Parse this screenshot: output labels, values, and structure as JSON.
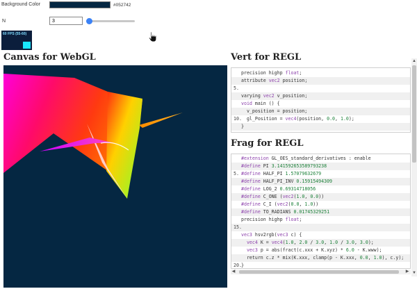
{
  "controls": {
    "bg_label": "Background Color",
    "bg_hex": "#052742",
    "n_label": "N",
    "n_value": "3",
    "n_slider_fraction": 0.03
  },
  "fps": {
    "label": "60 FPS (55-60)"
  },
  "canvas": {
    "title": "Canvas for WebGL"
  },
  "vert": {
    "title": "Vert for REGL",
    "lines": [
      {
        "n": "",
        "t": "precision highp float;"
      },
      {
        "n": "",
        "t": "attribute vec2 position;"
      },
      {
        "n": "5.",
        "t": ""
      },
      {
        "n": "",
        "t": "varying vec2 v_position;"
      },
      {
        "n": "",
        "t": "void main () {"
      },
      {
        "n": "",
        "t": "  v_position = position;"
      },
      {
        "n": "10.",
        "t": "  gl_Position = vec4(position, 0.0, 1.0);"
      },
      {
        "n": "",
        "t": "}"
      }
    ]
  },
  "frag": {
    "title": "Frag for REGL",
    "lines": [
      {
        "n": "",
        "t": "#extension GL_OES_standard_derivatives : enable"
      },
      {
        "n": "",
        "t": "#define PI 3.141592653589793238"
      },
      {
        "n": "5.",
        "t": "#define HALF_PI 1.57079632679"
      },
      {
        "n": "",
        "t": "#define HALF_PI_INV 0.15915494309"
      },
      {
        "n": "",
        "t": "#define LOG_2 0.69314718056"
      },
      {
        "n": "",
        "t": "#define C_ONE (vec2(1.0, 0.0))"
      },
      {
        "n": "",
        "t": "#define C_I (vec2(0.0, 1.0))"
      },
      {
        "n": "",
        "t": "#define TO_RADIANS 0.01745329251"
      },
      {
        "n": "",
        "t": "precision highp float;"
      },
      {
        "n": "15.",
        "t": ""
      },
      {
        "n": "",
        "t": "vec3 hsv2rgb(vec3 c) {"
      },
      {
        "n": "",
        "t": "  vec4 K = vec4(1.0, 2.0 / 3.0, 1.0 / 3.0, 3.0);"
      },
      {
        "n": "",
        "t": "  vec3 p = abs(fract(c.xxx + K.xyz) * 6.0 - K.www);"
      },
      {
        "n": "",
        "t": "  return c.z * mix(K.xxx, clamp(p - K.xxx, 0.0, 1.0), c.y);"
      },
      {
        "n": "20.",
        "t": "}"
      }
    ]
  },
  "colors": {
    "canvas_bg": "#052742",
    "accent": "#3b82f6",
    "fps_bar": "#19e8ff"
  },
  "icons": {
    "cursor": "hand-cursor-icon"
  }
}
